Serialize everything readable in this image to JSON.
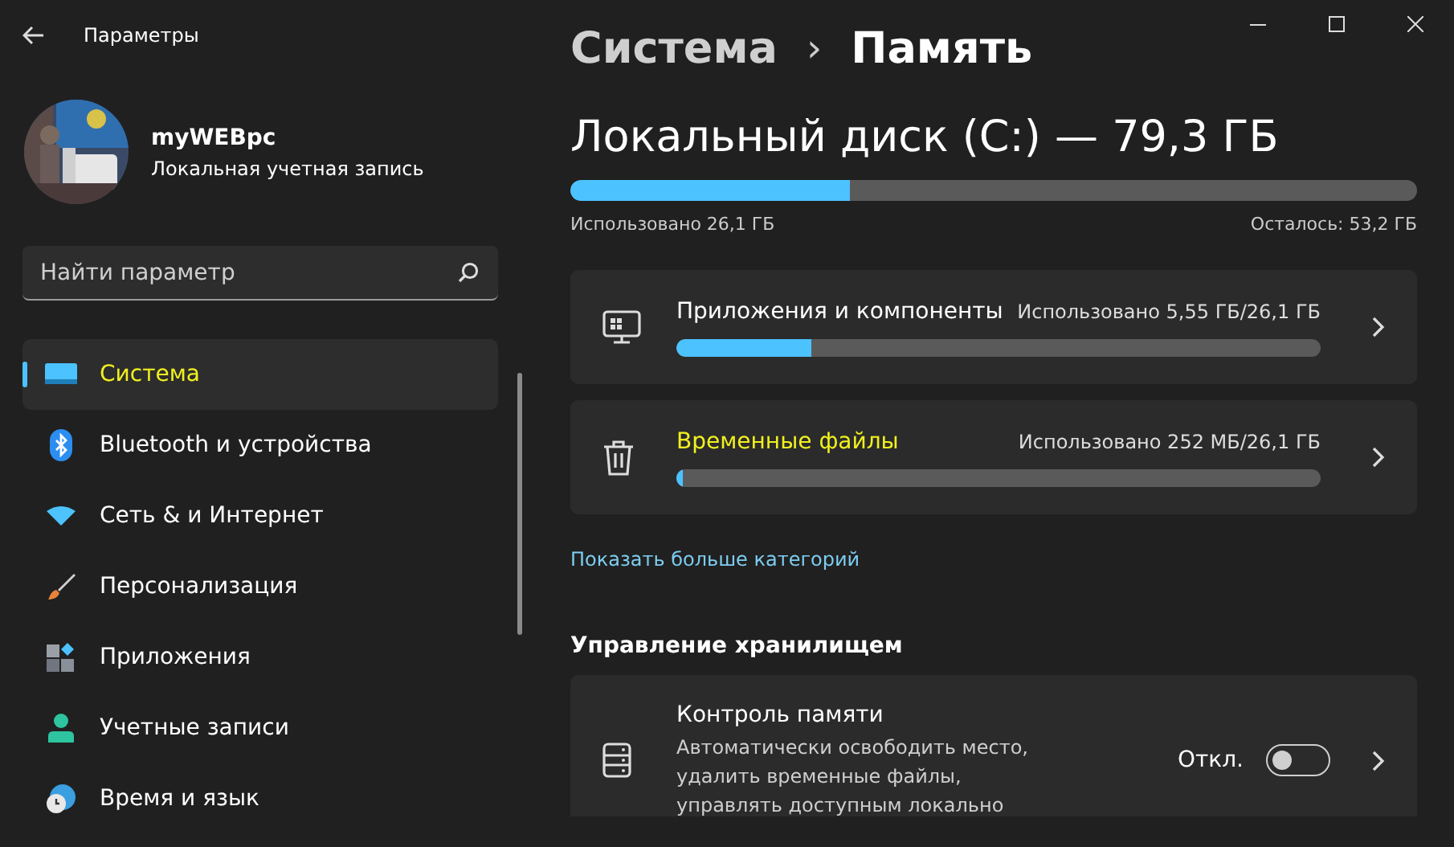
{
  "window": {
    "title": "Параметры"
  },
  "account": {
    "name": "myWEBpc",
    "type": "Локальная учетная запись"
  },
  "search": {
    "placeholder": "Найти параметр"
  },
  "sidebar": {
    "items": [
      {
        "label": "Система",
        "selected": true,
        "highlighted": true
      },
      {
        "label": "Bluetooth и устройства",
        "selected": false,
        "highlighted": false
      },
      {
        "label": "Сеть & и Интернет",
        "selected": false,
        "highlighted": false
      },
      {
        "label": "Персонализация",
        "selected": false,
        "highlighted": false
      },
      {
        "label": "Приложения",
        "selected": false,
        "highlighted": false
      },
      {
        "label": "Учетные записи",
        "selected": false,
        "highlighted": false
      },
      {
        "label": "Время и язык",
        "selected": false,
        "highlighted": false
      }
    ]
  },
  "breadcrumb": {
    "parent": "Система",
    "separator": "›",
    "current": "Память"
  },
  "disk": {
    "title": "Локальный диск (C:) — 79,3 ГБ",
    "level": 0.33,
    "used": "Использовано 26,1 ГБ",
    "free": "Осталось: 53,2 ГБ"
  },
  "categories": [
    {
      "label": "Приложения и компоненты",
      "usage": "Использовано 5,55 ГБ/26,1 ГБ",
      "level": 0.21,
      "highlighted": false
    },
    {
      "label": "Временные файлы",
      "usage": "Использовано 252 МБ/26,1 ГБ",
      "level": 0.01,
      "highlighted": true
    }
  ],
  "show_more": "Показать больше категорий",
  "storage_management": {
    "heading": "Управление хранилищем",
    "items": [
      {
        "title": "Контроль памяти",
        "description_lines": [
          "Автоматически освободить место,",
          "удалить временные файлы,",
          "управлять доступным локально"
        ],
        "state_label": "Откл.",
        "on": false
      }
    ]
  }
}
